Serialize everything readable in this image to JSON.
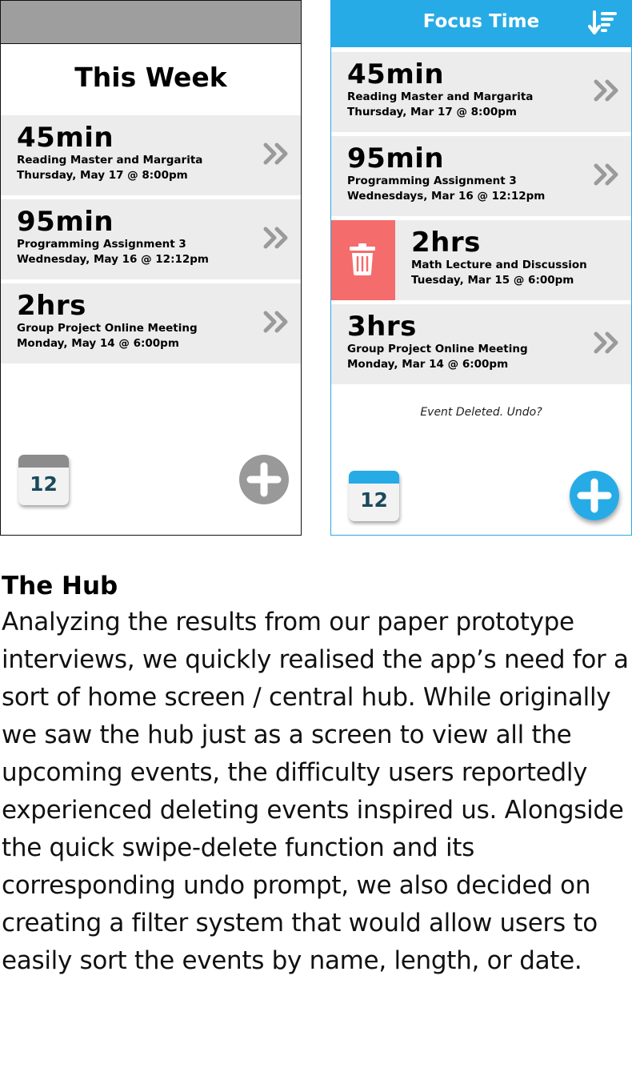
{
  "left_phone": {
    "heading": "This Week",
    "events": [
      {
        "duration": "45min",
        "title": "Reading Master and Margarita",
        "datetime": "Thursday, May 17 @ 8:00pm"
      },
      {
        "duration": "95min",
        "title": "Programming Assignment 3",
        "datetime": "Wednesday, May 16 @ 12:12pm"
      },
      {
        "duration": "2hrs",
        "title": "Group Project Online Meeting",
        "datetime": "Monday, May 14 @ 6:00pm"
      }
    ],
    "calendar_day": "12",
    "colors": {
      "topbar": "#9e9e9e",
      "calendar_accent": "#8c8c8c",
      "add_button": "#999999"
    }
  },
  "right_phone": {
    "title": "Focus Time",
    "events": [
      {
        "duration": "45min",
        "title": "Reading Master and Margarita",
        "datetime": "Thursday, Mar 17 @ 8:00pm"
      },
      {
        "duration": "95min",
        "title": "Programming Assignment 3",
        "datetime": "Wednesdays, Mar 16 @ 12:12pm"
      },
      {
        "duration": "2hrs",
        "title": "Math Lecture and Discussion",
        "datetime": "Tuesday, Mar 15 @ 6:00pm",
        "swiped": true
      },
      {
        "duration": "3hrs",
        "title": "Group Project Online Meeting",
        "datetime": "Monday, Mar 14 @ 6:00pm"
      }
    ],
    "undo_prompt": "Event Deleted. Undo?",
    "calendar_day": "12",
    "colors": {
      "topbar": "#26abe6",
      "delete": "#f46c6c",
      "calendar_accent": "#26abe6",
      "add_button": "#26abe6"
    }
  },
  "article": {
    "title": "The Hub",
    "body": "Analyzing the results from our paper prototype interviews, we quickly realised the app’s need for a sort of home screen / central hub. While originally we saw the hub just as a screen to view all the upcoming events, the difficulty users reportedly experienced deleting events inspired us. Alongside the quick swipe-delete function and its corresponding undo prompt, we also decided on creating a filter system that would allow users to easily sort the events by name, length, or date."
  },
  "icons": [
    "chevron-double-right-icon",
    "trash-icon",
    "calendar-icon",
    "plus-icon",
    "sort-icon"
  ]
}
